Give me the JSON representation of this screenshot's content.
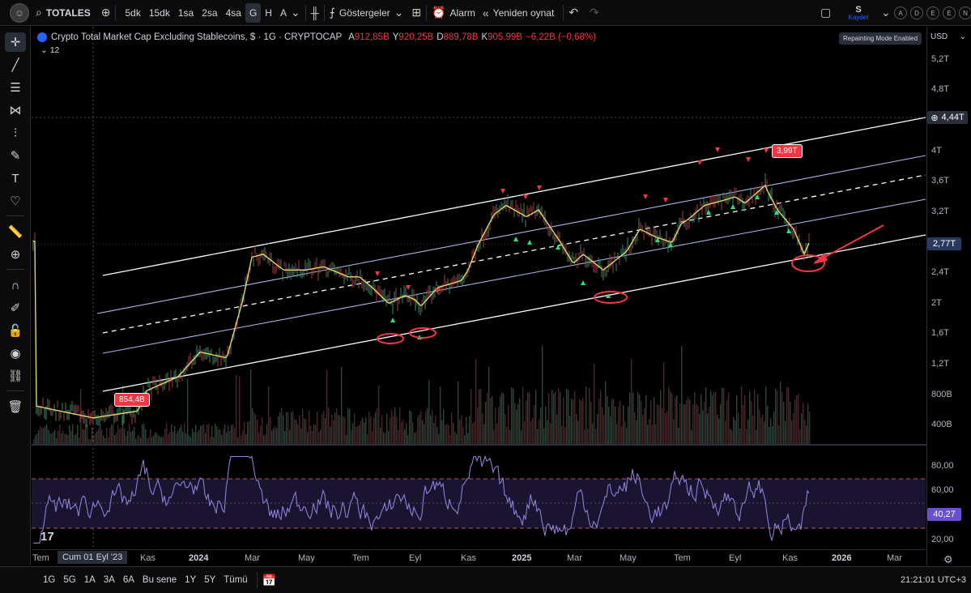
{
  "topbar": {
    "symbol": "TOTALES",
    "intervals": [
      "5dk",
      "15dk",
      "1sa",
      "2sa",
      "4sa",
      "G",
      "H",
      "A"
    ],
    "active_interval": "G",
    "indicators_label": "Göstergeler",
    "alarm_label": "Alarm",
    "replay_label": "Yeniden oynat",
    "save_symbol": "S",
    "save_label": "Kaydet",
    "circle_buttons": [
      "A",
      "D",
      "E",
      "E",
      "N"
    ]
  },
  "legend": {
    "title": "Crypto Total Market Cap Excluding Stablecoins, $ · 1G · CRYPTOCAP",
    "open_k": "A",
    "open_v": "912,85B",
    "high_k": "Y",
    "high_v": "920,25B",
    "low_k": "D",
    "low_v": "889,78B",
    "close_k": "K",
    "close_v": "905,99B",
    "change": "−6,22B (−0,68%)",
    "indicator_value": "12"
  },
  "repaint_label": "Repainting Mode Enabled",
  "price_axis": {
    "currency": "USD",
    "labels": [
      "5,2T",
      "4,8T",
      "4T",
      "3,6T",
      "3,2T",
      "2,4T",
      "2T",
      "1,6T",
      "1,2T",
      "800B",
      "400B"
    ],
    "crosshair_value": "4,44T",
    "current_value": "2,77T"
  },
  "rsi_axis": {
    "labels": [
      "80,00",
      "60,00",
      "20,00"
    ],
    "current_value": "40,27"
  },
  "annotations": {
    "low_label": "854,4B",
    "high_label": "3,99T"
  },
  "time_axis": {
    "cursor_label": "Cum 01 Eyl '23",
    "labels": [
      "Tem",
      "Kas",
      "2024",
      "Mar",
      "May",
      "Tem",
      "Eyl",
      "Kas",
      "2025",
      "Mar",
      "May",
      "Tem",
      "Eyl",
      "Kas",
      "2026",
      "Mar"
    ]
  },
  "bottombar": {
    "ranges": [
      "1G",
      "5G",
      "1A",
      "3A",
      "6A",
      "Bu sene",
      "1Y",
      "5Y",
      "Tümü"
    ],
    "time": "21:21:01 UTC+3"
  },
  "chart_data": {
    "type": "line",
    "series": [
      {
        "name": "",
        "x": [
          "2023-07",
          "2023-09",
          "2023-11",
          "2024-01",
          "2024-03",
          "2024-05",
          "2024-07",
          "2024-09",
          "2024-11",
          "2025-01",
          "2025-03",
          "2025-05",
          "2025-07",
          "2025-09",
          "2025-10",
          "2025-11"
        ],
        "values": [
          0.95,
          0.88,
          1.05,
          1.35,
          2.5,
          2.3,
          2.2,
          1.9,
          2.3,
          3.3,
          2.4,
          2.6,
          3.1,
          3.7,
          3.99,
          2.77
        ]
      }
    ],
    "ylim": [
      0.4,
      5.4
    ],
    "scale": "log"
  },
  "colors": {
    "bg": "#000000",
    "price_line": "#e6d36b",
    "channel_white": "#ffffff",
    "channel_blue": "#a9b8e8",
    "rsi_line": "#8b7fd6",
    "red_marker": "#f23645",
    "green_marker": "#26e07a",
    "accent": "#2962ff"
  }
}
